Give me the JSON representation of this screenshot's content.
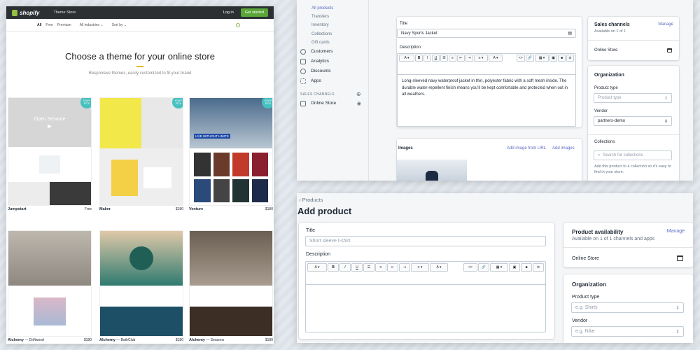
{
  "store": {
    "logo": "shopify",
    "theme_store": "Theme Store",
    "login": "Log in",
    "get_started": "Get started",
    "filters": [
      "All",
      "Free",
      "Premium",
      "All industries",
      "Sort by"
    ],
    "title": "Choose a theme for your online store",
    "subtitle": "Responsive themes, easily customized to fit your brand",
    "badge": "STAFF PICK",
    "themes": [
      {
        "name": "Jumpstart",
        "sub": "",
        "price": "Free",
        "banner": "Open Sesame",
        "bg": "#d9d9d9"
      },
      {
        "name": "Maker",
        "sub": "",
        "price": "$180",
        "banner": "",
        "bg": "#f3e84a"
      },
      {
        "name": "Venture",
        "sub": "",
        "price": "$180",
        "banner": "LIVE WITHOUT LIMITS",
        "bg": "#3f5a78"
      },
      {
        "name": "Alchemy",
        "sub": "Driftwood",
        "price": "$180",
        "banner": "",
        "bg": "#9e9a94"
      },
      {
        "name": "Alchemy",
        "sub": "BathClub",
        "price": "$180",
        "banner": "",
        "bg": "#2d6b63"
      },
      {
        "name": "Alchemy",
        "sub": "Seasons",
        "price": "$180",
        "banner": "",
        "bg": "#5a4a3a"
      }
    ]
  },
  "admin": {
    "nav_subs": [
      "All products",
      "Transfers",
      "Inventory",
      "Collections",
      "Gift cards"
    ],
    "nav_main": [
      "Customers",
      "Analytics",
      "Discounts",
      "Apps"
    ],
    "sales_channels": "SALES CHANNELS",
    "online_store": "Online Store",
    "title_label": "Title",
    "title_value": "Navy Sports Jacket",
    "desc_label": "Description",
    "desc_text": "Long-sleeved navy waterproof jacket in thin, polyester fabric with a soft mesh inside. The durable water-repellent finish means you’ll be kept comfortable and protected when out in all weathers.",
    "images_label": "Images",
    "add_url": "Add image from URL",
    "add_images": "Add images",
    "sc_title": "Sales channels",
    "sc_manage": "Manage",
    "sc_sub": "Available on 1 of 1",
    "sc_store": "Online Store",
    "org": "Organization",
    "ptype_label": "Product type",
    "ptype_ph": "Product type",
    "vendor_label": "Vendor",
    "vendor_value": "partners-demo",
    "coll_label": "Collections",
    "coll_ph": "Search for collections",
    "coll_help": "Add this product to a collection so it’s easy to find in your store."
  },
  "add": {
    "back": "Products",
    "title": "Add product",
    "title_label": "Title",
    "title_ph": "Short sleeve t-shirt",
    "desc_label": "Description",
    "pa_title": "Product availability",
    "pa_manage": "Manage",
    "pa_sub": "Available on 1 of 1 channels and apps",
    "pa_store": "Online Store",
    "org": "Organization",
    "ptype_label": "Product type",
    "ptype_ph": "e.g. Shirts",
    "vendor_label": "Vendor",
    "vendor_ph": "e.g. Nike"
  }
}
